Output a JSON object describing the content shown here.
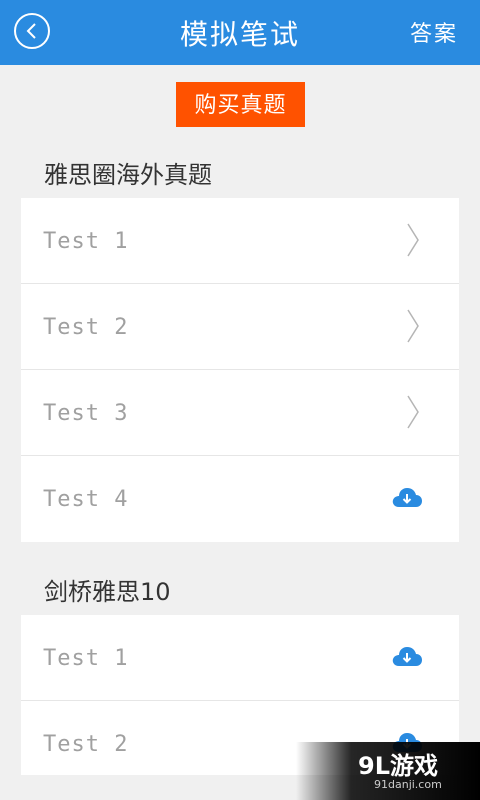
{
  "header": {
    "title": "模拟笔试",
    "answer_label": "答案",
    "color": "#2a8be0"
  },
  "buy_button": {
    "label": "购买真题",
    "color": "#ff5200"
  },
  "sections": [
    {
      "title": "雅思圈海外真题",
      "items": [
        {
          "label": "Test  1",
          "icon": "chevron-right-icon"
        },
        {
          "label": "Test  2",
          "icon": "chevron-right-icon"
        },
        {
          "label": "Test  3",
          "icon": "chevron-right-icon"
        },
        {
          "label": "Test  4",
          "icon": "cloud-download-icon"
        }
      ]
    },
    {
      "title": "剑桥雅思10",
      "items": [
        {
          "label": "Test  1",
          "icon": "cloud-download-icon"
        },
        {
          "label": "Test  2",
          "icon": "cloud-download-icon"
        }
      ]
    }
  ],
  "watermark": {
    "main": "9L游戏",
    "sub": "91danji.com"
  }
}
